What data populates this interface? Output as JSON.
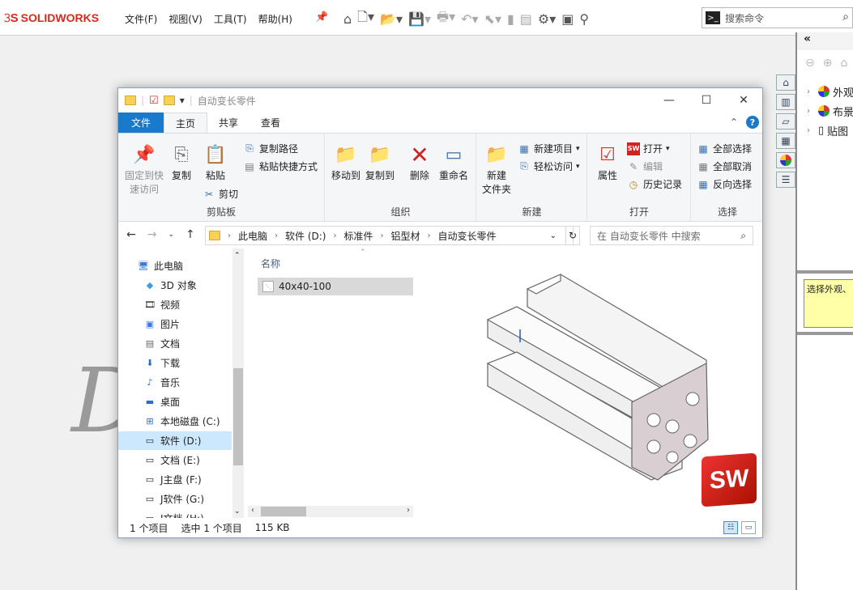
{
  "solidworks": {
    "logo": "SOLIDWORKS",
    "menu": [
      "文件(F)",
      "视图(V)",
      "工具(T)",
      "帮助(H)"
    ],
    "search_placeholder": "搜索命令"
  },
  "taskpane": {
    "collapse": "«",
    "items": [
      "外观",
      "布景",
      "贴图"
    ],
    "note": "选择外观、"
  },
  "explorer": {
    "title": "自动变长零件",
    "tabs": [
      "文件",
      "主页",
      "共享",
      "查看"
    ],
    "ribbon": {
      "clipboard": {
        "label": "剪贴板",
        "pin": "固定到快速访问",
        "pin_l1": "固定到快",
        "pin_l2": "速访问",
        "copy": "复制",
        "paste": "粘贴",
        "copy_path": "复制路径",
        "paste_shortcut": "粘贴快捷方式",
        "cut": "剪切"
      },
      "organize": {
        "label": "组织",
        "move_to": "移动到",
        "copy_to": "复制到",
        "delete": "删除",
        "rename": "重命名"
      },
      "new": {
        "label": "新建",
        "new_folder_l1": "新建",
        "new_folder_l2": "文件夹",
        "new_item": "新建项目",
        "easy_access": "轻松访问"
      },
      "open": {
        "label": "打开",
        "properties": "属性",
        "open": "打开",
        "edit": "编辑",
        "history": "历史记录"
      },
      "select": {
        "label": "选择",
        "select_all": "全部选择",
        "select_none": "全部取消",
        "invert": "反向选择"
      }
    },
    "address": [
      "此电脑",
      "软件 (D:)",
      "标准件",
      "铝型材",
      "自动变长零件"
    ],
    "search_placeholder": "在 自动变长零件 中搜索",
    "nav": [
      "此电脑",
      "3D 对象",
      "视频",
      "图片",
      "文档",
      "下载",
      "音乐",
      "桌面",
      "本地磁盘 (C:)",
      "软件 (D:)",
      "文档 (E:)",
      "J主盘 (F:)",
      "J软件 (G:)",
      "J文档 (H:)"
    ],
    "column_name": "名称",
    "file": "40x40-100",
    "status": {
      "count": "1 个项目",
      "selected": "选中 1 个项目",
      "size": "115 KB"
    }
  }
}
